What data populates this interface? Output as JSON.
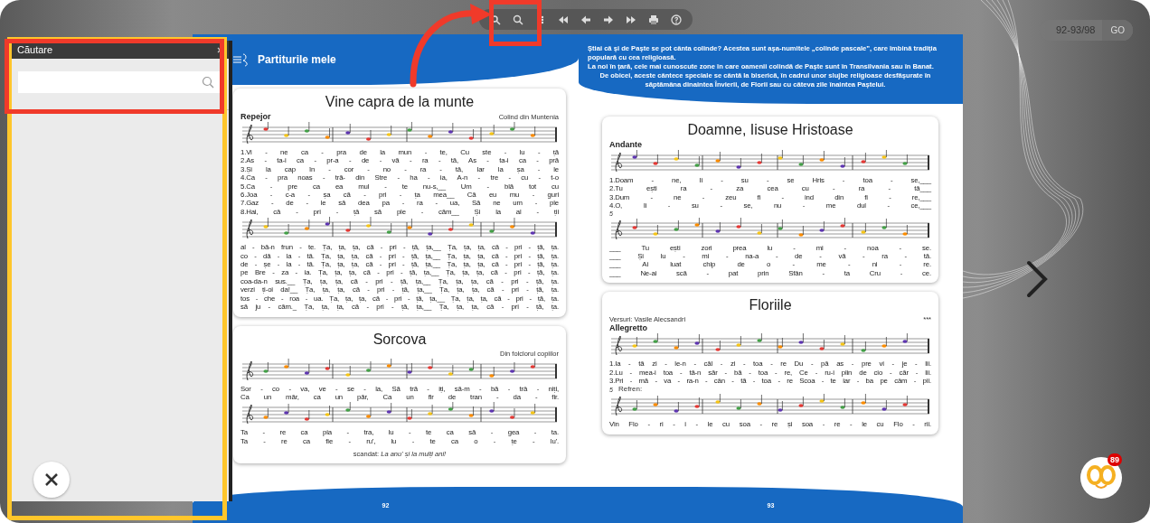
{
  "search_panel": {
    "title": "Căutare"
  },
  "page_counter": {
    "value": "92-93/98",
    "go_label": "GO"
  },
  "pages": [
    {
      "number": "92",
      "header_title": "Partiturile mele",
      "songs": [
        {
          "title": "Vine capra de la munte",
          "tempo": "Repejor",
          "source": "Colind din Muntenia",
          "systems": [
            {
              "lines": [
                "1.Vi - ne ca - pra de la mun - te, Cu ste - lu - ță",
                "2.As - ta-i ca - pr-a - de - vă - ra - tă, As - ta-i ca - pră",
                "3.Și la cap în - cor - no - ra - tă, Iar la șa - le",
                "4.Ca - pra noas - tră- din Stre - ha - ia, A-n - tre - cu - t-o",
                "5.Ca - pre ca ea mul - te nu-s,__ Um - blă tot cu",
                "6.Joa - c-a - șa că - pri - ța mea__ Că eu mu - guri",
                "7.Gaz - de - le să dea pa - ra - ua, Să ne um - ple",
                "8.Hai, că - pri - ță să ple - căm__ Și la al - ții"
              ]
            },
            {
              "lines": [
                "al - bă-n frun - te. Ța, ța, ța, că - pri - ță, ța,__ Ța, ța, ța, că - pri - ță, ța.",
                "co - dă - la - tă. Ța, ța, ța, că - pri - ță, ța,__ Ța, ța, ța, că - pri - ță, ța.",
                "de - șe - la - tă. Ța, ța, ța, că - pri - ță, ța,__ Ța, ța, ța, că - pri - ță, ța.",
                "pe Bre - za - ia. Ța, ța, ța, că - pri - ță, ța,__ Ța, ța, ța, că - pri - ță, ța.",
                "coa-da-n sus.__ Ța, ța, ța, că - pri - ță, ța,__ Ța, ța, ța, că - pri - ță, ța.",
                "verzi ți-oi da!__ Ța, ța, ța, că - pri - ță, ța,__ Ța, ța, ța, că - pri - ță, ța.",
                "tos - che - roa - ua. Ța, ța, ța, că - pri - ță, ța,__ Ța, ța, ța, că - pri - ță, ța.",
                "să ju - căm._ Ța, ța, ța, că - pri - ță, ța,__ Ța, ța, ța, că - pri - ță, ța."
              ]
            }
          ]
        },
        {
          "title": "Sorcova",
          "source": "Din folclorul copiilor",
          "systems": [
            {
              "lines": [
                "Sor - co - va, ve - se - la, Să tră - iți, să-m - bă - trâ - niți,",
                "Ca un măr, ca un păr, Ca un fir de tran - da - fir."
              ]
            },
            {
              "lines": [
                "Ta - re ca pia - tra, lu - te ca să - gea - ta.",
                "Ta - re ca fie - ru', lu - te ca o - țe - lu'."
              ]
            }
          ],
          "footnote": "scandat: *La anu' și la mulți ani!*"
        }
      ]
    },
    {
      "number": "93",
      "intro": [
        "Știai că și de Paște se pot cânta colinde? Acestea sunt așa-numitele „colinde pascale”, care îmbină tradiția populară cu cea religioasă.",
        "La noi în țară, cele mai cunoscute zone în care oamenii colindă de Paște sunt în Transilvania sau în Banat.",
        "De obicei, aceste cântece speciale se cântă la biserică, în cadrul unor slujbe religioase desfășurate în săptămâna dinaintea Învierii, de Florii sau cu câteva zile înaintea Paștelui."
      ],
      "songs": [
        {
          "title": "Doamne, Iisuse Hristoase",
          "tempo": "Andante",
          "systems": [
            {
              "lines": [
                "1.Doam - ne, Ii - su - se Hris - toa - se,___",
                "2.Tu ești ra - za cea cu - ra - tă___",
                "3.Dum - ne - zeu fi - ind din fi - re,___",
                "4.O, Ii - su - se, nu - me dul - ce,___"
              ]
            },
            {
              "measure_number": "5",
              "lines": [
                "___ Tu ești zori prea lu - mi - noa - se.",
                "___ Și lu - mi - na-a - de - vă - ra - tă.",
                "___ Ai luat chip de o - me - ni - re.",
                "___ Ne-ai scă - pat prin Sfân - ta Cru - ce."
              ]
            }
          ]
        },
        {
          "title": "Floriile",
          "credit": "Versuri: Vasile Alecsandri",
          "mark": "***",
          "tempo": "Allegretto",
          "systems": [
            {
              "lines": [
                "1.Ia - tă zi - le-n - căl - zi - toa - re Du - pă as - pre vi - je - lii.",
                "2.Lu - mea-i toa - tă-n săr - bă - toa - re, Ce - ru-i plin de cio - căr - lii.",
                "3.Pri - mă - va - ra-n - cân - tă - toa - re Scoa - te iar - ba pe câm - pii."
              ]
            },
            {
              "measure_number": "5",
              "label": "Refren:",
              "lines": [
                "Vin Flo - ri - i - le cu soa - re și soa - re - le cu Flo - rii."
              ]
            }
          ]
        }
      ]
    }
  ],
  "mascot": {
    "badge": "89"
  }
}
